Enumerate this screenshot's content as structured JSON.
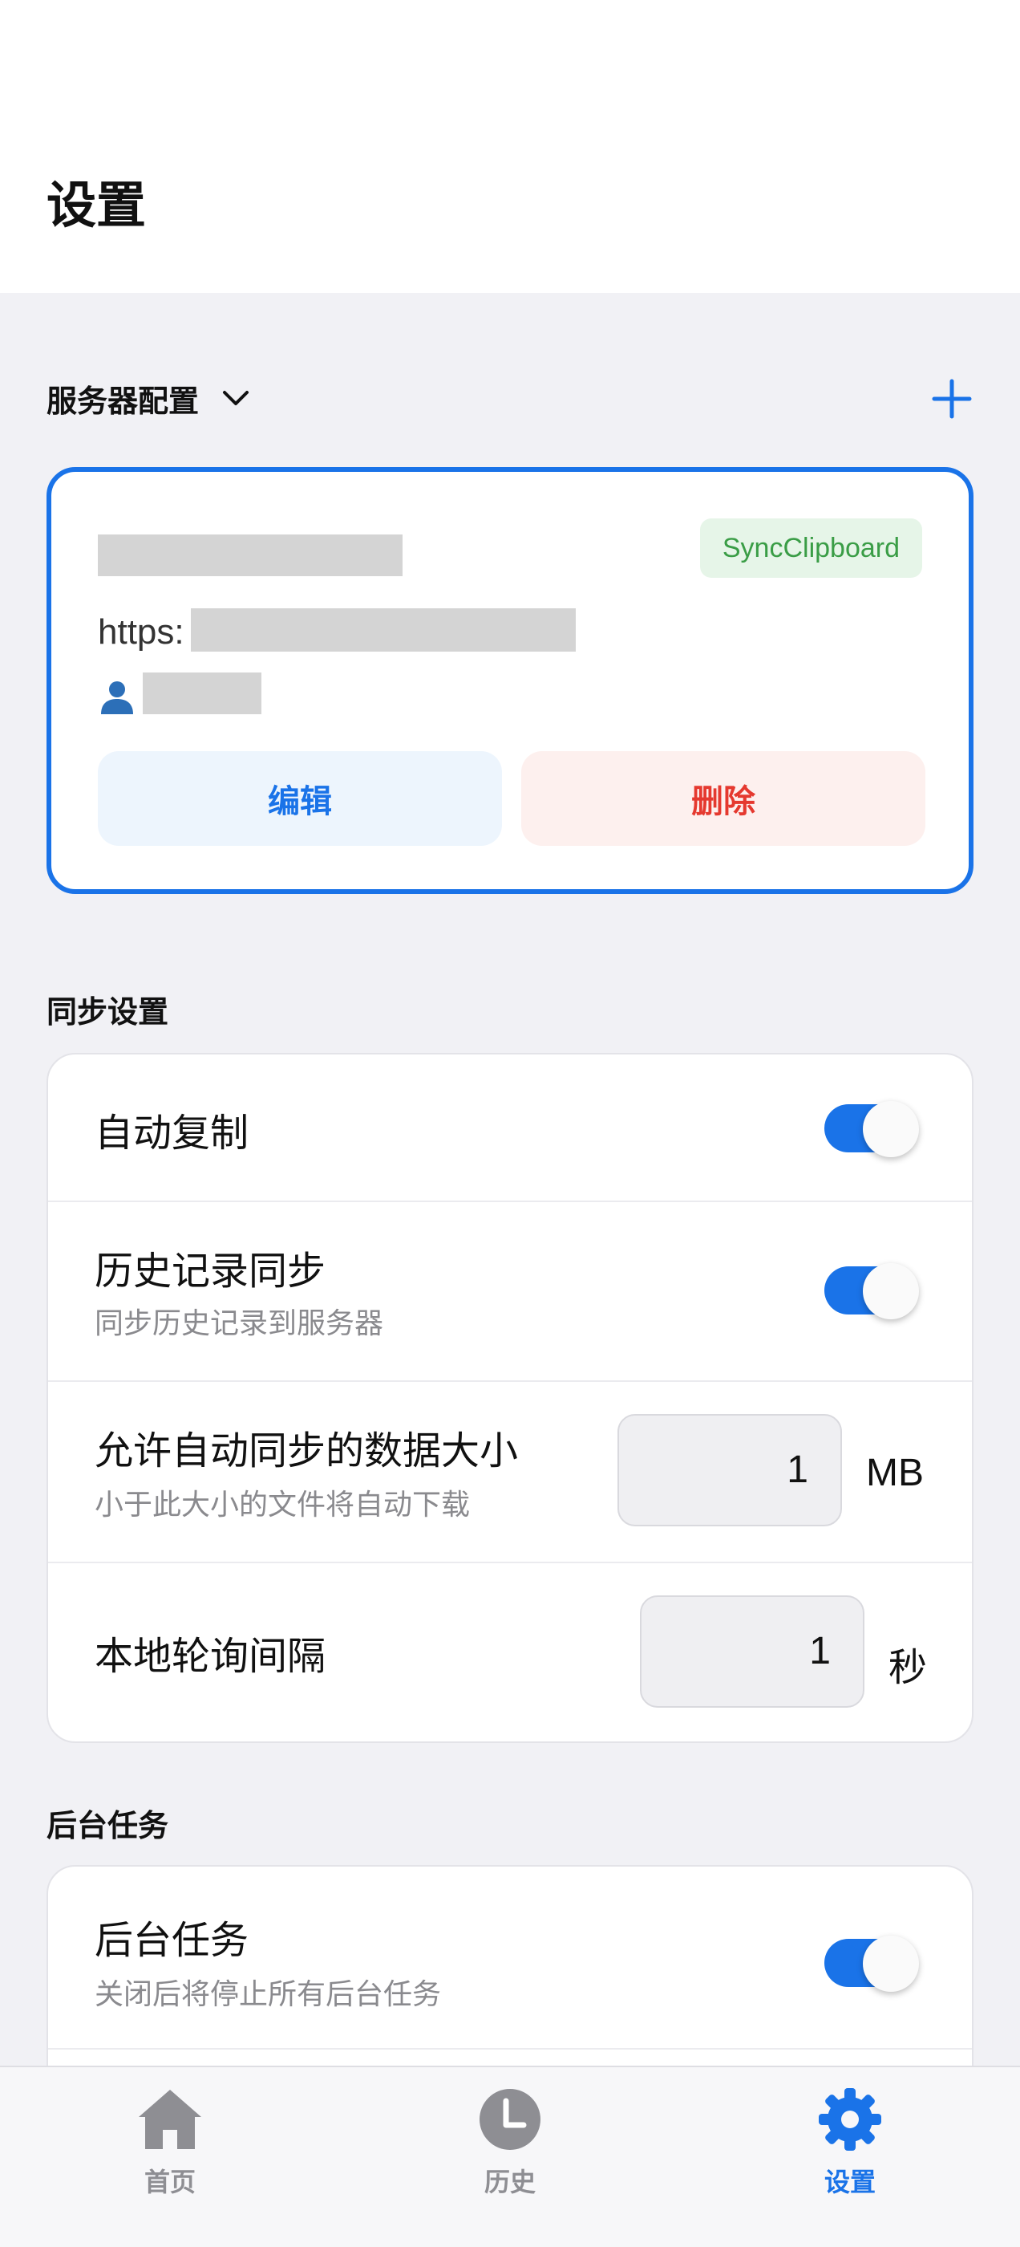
{
  "header": {
    "title": "设置"
  },
  "server_section": {
    "label": "服务器配置",
    "card": {
      "badge": "SyncClipboard",
      "url_prefix": "https:",
      "edit_label": "编辑",
      "delete_label": "删除"
    }
  },
  "sync_section": {
    "title": "同步设置",
    "auto_copy": {
      "title": "自动复制",
      "enabled": true
    },
    "history_sync": {
      "title": "历史记录同步",
      "subtitle": "同步历史记录到服务器",
      "enabled": true
    },
    "max_size": {
      "title": "允许自动同步的数据大小",
      "subtitle": "小于此大小的文件将自动下载",
      "value": "1",
      "unit": "MB"
    },
    "poll_interval": {
      "title": "本地轮询间隔",
      "value": "1",
      "unit": "秒"
    }
  },
  "background_section": {
    "title": "后台任务",
    "background_task": {
      "title": "后台任务",
      "subtitle": "关闭后将停止所有后台任务",
      "enabled": true
    }
  },
  "bottom_nav": {
    "home": "首页",
    "history": "历史",
    "settings": "设置",
    "active": "settings"
  },
  "colors": {
    "accent": "#1a73e8",
    "danger": "#e5392f",
    "badge_green": "#3a9d46"
  }
}
